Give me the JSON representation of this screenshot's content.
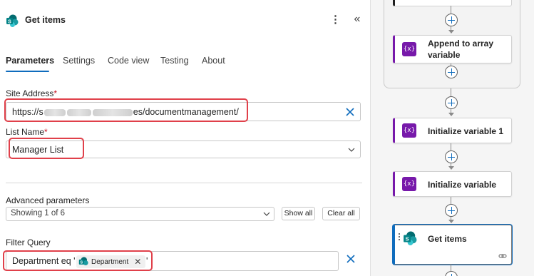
{
  "panel": {
    "title": "Get items",
    "more_glyph": "⋮",
    "collapse_glyph": "«",
    "tabs": [
      {
        "label": "Parameters",
        "active": true
      },
      {
        "label": "Settings"
      },
      {
        "label": "Code view"
      },
      {
        "label": "Testing"
      },
      {
        "label": "About"
      }
    ],
    "site_address": {
      "label": "Site Address",
      "required_mark": "*",
      "value_prefix": "https://s",
      "value_suffix": "es/documentmanagement/"
    },
    "list_name": {
      "label": "List Name",
      "required_mark": "*",
      "value": "Manager List"
    },
    "advanced": {
      "label": "Advanced parameters",
      "value": "Showing 1 of 6",
      "show_all": "Show all",
      "clear_all": "Clear all"
    },
    "filter_query": {
      "label": "Filter Query",
      "prefix": "Department eq '",
      "token": "Department",
      "token_close": "✕",
      "suffix": "'"
    }
  },
  "canvas": {
    "cards": [
      {
        "label": "Append to array variable",
        "icon": "variable-icon",
        "icon_text": "{x}"
      },
      {
        "label": "Initialize variable 1",
        "icon": "variable-icon",
        "icon_text": "{x}"
      },
      {
        "label": "Initialize variable",
        "icon": "variable-icon",
        "icon_text": "{x}"
      },
      {
        "label": "Get items",
        "icon": "sharepoint-icon",
        "selected": true
      }
    ]
  },
  "colors": {
    "accent": "#0f6cbd",
    "variable_purple": "#7719aa",
    "highlight_red": "#e0404a",
    "sharepoint_teal": "#038387"
  }
}
